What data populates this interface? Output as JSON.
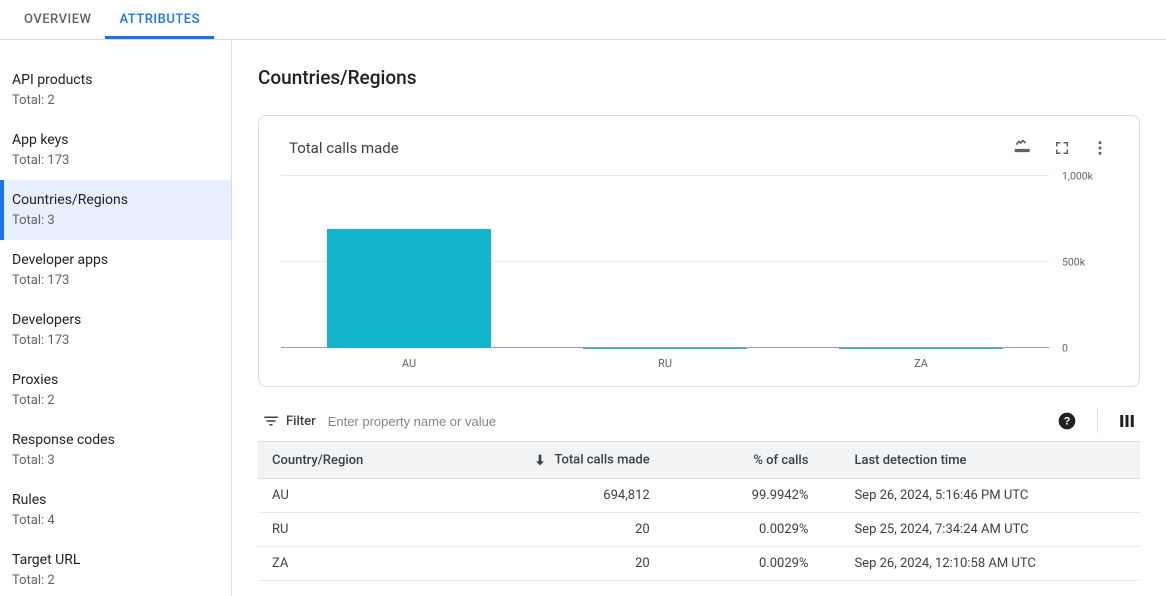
{
  "tabs": {
    "overview": "Overview",
    "attributes": "Attributes"
  },
  "sidebar": {
    "total_prefix": "Total: ",
    "items": [
      {
        "title": "API products",
        "total": "2"
      },
      {
        "title": "App keys",
        "total": "173"
      },
      {
        "title": "Countries/Regions",
        "total": "3"
      },
      {
        "title": "Developer apps",
        "total": "173"
      },
      {
        "title": "Developers",
        "total": "173"
      },
      {
        "title": "Proxies",
        "total": "2"
      },
      {
        "title": "Response codes",
        "total": "3"
      },
      {
        "title": "Rules",
        "total": "4"
      },
      {
        "title": "Target URL",
        "total": "2"
      }
    ],
    "selected_index": 2
  },
  "page": {
    "title": "Countries/Regions"
  },
  "chart_card": {
    "title": "Total calls made"
  },
  "chart_data": {
    "type": "bar",
    "categories": [
      "AU",
      "RU",
      "ZA"
    ],
    "values": [
      694812,
      20,
      20
    ],
    "title": "Total calls made",
    "xlabel": "",
    "ylabel": "",
    "ylim": [
      0,
      1000000
    ],
    "yticks": [
      {
        "value": 0,
        "label": "0"
      },
      {
        "value": 500000,
        "label": "500k"
      },
      {
        "value": 1000000,
        "label": "1,000k"
      }
    ]
  },
  "filter": {
    "label": "Filter",
    "placeholder": "Enter property name or value"
  },
  "table": {
    "columns": {
      "country": "Country/Region",
      "calls": "Total calls made",
      "percent": "% of calls",
      "last": "Last detection time"
    },
    "rows": [
      {
        "country": "AU",
        "calls": "694,812",
        "percent": "99.9942%",
        "last": "Sep 26, 2024, 5:16:46 PM UTC"
      },
      {
        "country": "RU",
        "calls": "20",
        "percent": "0.0029%",
        "last": "Sep 25, 2024, 7:34:24 AM UTC"
      },
      {
        "country": "ZA",
        "calls": "20",
        "percent": "0.0029%",
        "last": "Sep 26, 2024, 12:10:58 AM UTC"
      }
    ]
  }
}
